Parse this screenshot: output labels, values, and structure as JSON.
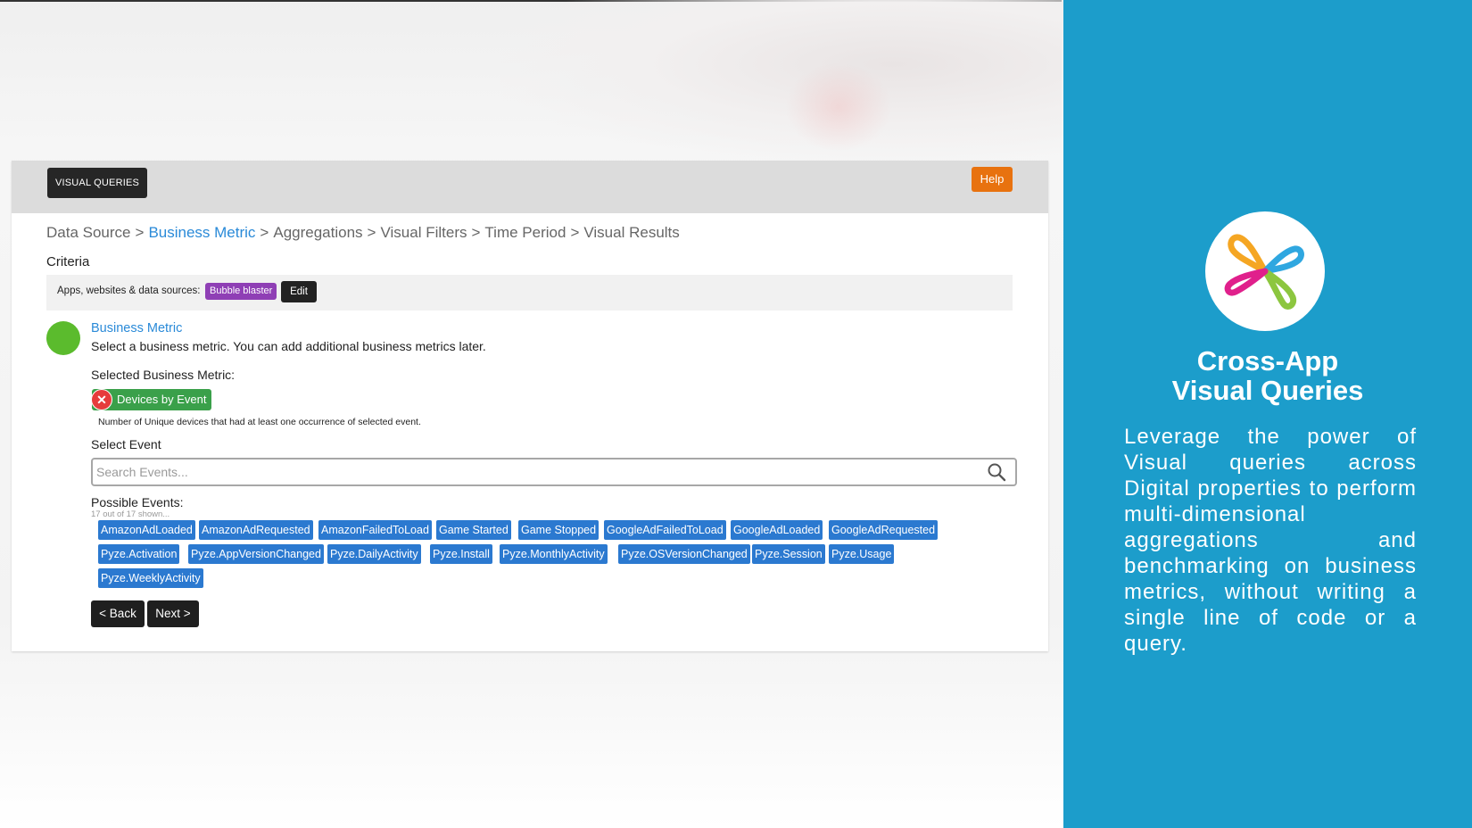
{
  "app": {
    "tab_label": "VISUAL QUERIES",
    "help_label": "Help"
  },
  "breadcrumb": [
    {
      "label": "Data Source",
      "active": false
    },
    {
      "label": "Business Metric",
      "active": true
    },
    {
      "label": "Aggregations",
      "active": false
    },
    {
      "label": "Visual Filters",
      "active": false
    },
    {
      "label": "Time Period",
      "active": false
    },
    {
      "label": "Visual Results",
      "active": false
    }
  ],
  "criteria": {
    "title": "Criteria",
    "sources_label": "Apps, websites & data sources:",
    "source_badge": "Bubble blaster",
    "edit_label": "Edit"
  },
  "business_metric": {
    "title": "Business Metric",
    "description": "Select a business metric. You can add additional business metrics later.",
    "selected_label": "Selected Business Metric:",
    "selected_value": "Devices by Event",
    "note": "Number of Unique devices that had at least one occurrence of selected event."
  },
  "select_event": {
    "label": "Select Event",
    "placeholder": "Search Events...",
    "possible_label": "Possible Events:",
    "shown_count": "17 out of 17 shown..."
  },
  "events": [
    [
      "AmazonAdLoaded",
      "AmazonAdRequested",
      "AmazonFailedToLoad",
      "Game Started",
      "Game Stopped",
      "GoogleAdFailedToLoad",
      "GoogleAdLoaded",
      "GoogleAdRequested"
    ],
    [
      "Pyze.Activation",
      "Pyze.AppVersionChanged",
      "Pyze.DailyActivity",
      "Pyze.Install",
      "Pyze.MonthlyActivity",
      "Pyze.OSVersionChanged",
      "Pyze.Session",
      "Pyze.Usage"
    ],
    [
      "Pyze.WeeklyActivity"
    ]
  ],
  "nav": {
    "back_label": "< Back",
    "next_label": "Next >"
  },
  "promo": {
    "title_line1": "Cross-App",
    "title_line2": "Visual Queries",
    "body": "Leverage the power of Visual queries across Digital properties to perform multi-dimensional aggregations and benchmarking on business metrics, without writing a single line of code or a query."
  },
  "colors": {
    "accent_blue": "#2a8ad8",
    "event_chip": "#2b79d0",
    "help_orange": "#e8720f",
    "promo_bg": "#1c9dcb",
    "selected_green": "#3aa04a",
    "source_purple": "#8f3fb5"
  },
  "icons": [
    "search-icon",
    "remove-icon",
    "pyze-logo"
  ]
}
